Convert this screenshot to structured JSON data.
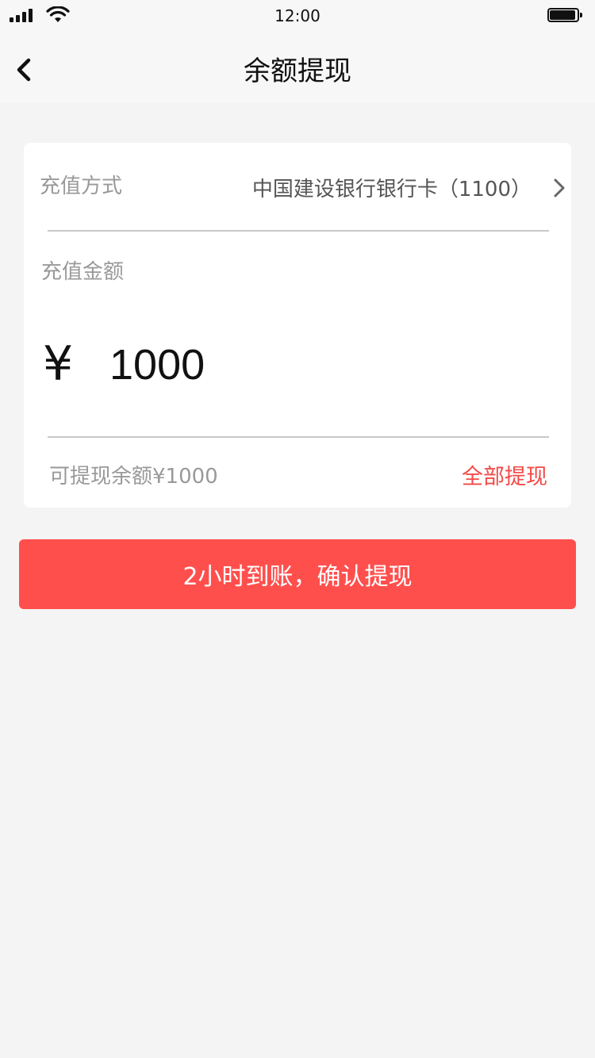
{
  "status_bar": {
    "time": "12:00",
    "icons": [
      "signal-icon",
      "wifi-icon",
      "battery-icon"
    ]
  },
  "nav": {
    "back_icon": "chevron-left-icon",
    "title": "余额提现"
  },
  "card": {
    "method": {
      "label": "充值方式",
      "value": "中国建设银行银行卡（1100）",
      "icon": "chevron-right-icon"
    },
    "amount": {
      "label": "充值金额",
      "currency": "¥",
      "value": "1000"
    },
    "available": "可提现余额¥1000",
    "withdraw_all": "全部提现"
  },
  "confirm_button": "2小时到账，确认提现",
  "colors": {
    "accent": "#ff4f4d",
    "accent_text": "#f24a47",
    "page_background": "#f4f4f4",
    "card_background": "#ffffff"
  }
}
